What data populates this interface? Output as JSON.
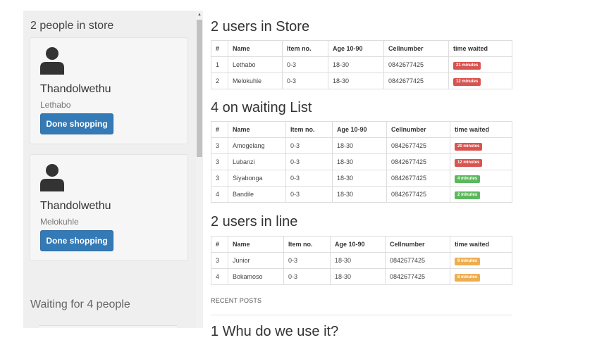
{
  "sidebar": {
    "in_store_heading": "2 people in store",
    "cards": [
      {
        "name": "Thandolwethu",
        "sub": "Lethabo",
        "button": "Done shopping"
      },
      {
        "name": "Thandolwethu",
        "sub": "Melokuhle",
        "button": "Done shopping"
      }
    ],
    "waiting_heading": "Waiting for 4 people"
  },
  "columns": [
    "#",
    "Name",
    "Item no.",
    "Age 10-90",
    "Cellnumber",
    "time waited"
  ],
  "store": {
    "title": "2 users in Store",
    "rows": [
      {
        "num": "1",
        "name": "Lethabo",
        "item": "0-3",
        "age": "18-30",
        "cell": "0842677425",
        "waited": "21 minutes",
        "status": "red"
      },
      {
        "num": "2",
        "name": "Melokuhle",
        "item": "0-3",
        "age": "18-30",
        "cell": "0842677425",
        "waited": "12 minutes",
        "status": "red"
      }
    ]
  },
  "waiting": {
    "title": "4 on waiting List",
    "rows": [
      {
        "num": "3",
        "name": "Amogelang",
        "item": "0-3",
        "age": "18-30",
        "cell": "0842677425",
        "waited": "20 minutes",
        "status": "red"
      },
      {
        "num": "3",
        "name": "Lubanzi",
        "item": "0-3",
        "age": "18-30",
        "cell": "0842677425",
        "waited": "12 minutes",
        "status": "red"
      },
      {
        "num": "3",
        "name": "Siyabonga",
        "item": "0-3",
        "age": "18-30",
        "cell": "0842677425",
        "waited": "4 minutes",
        "status": "green"
      },
      {
        "num": "4",
        "name": "Bandile",
        "item": "0-3",
        "age": "18-30",
        "cell": "0842677425",
        "waited": "2 minutes",
        "status": "green"
      }
    ]
  },
  "line": {
    "title": "2 users in line",
    "rows": [
      {
        "num": "3",
        "name": "Junior",
        "item": "0-3",
        "age": "18-30",
        "cell": "0842677425",
        "waited": "9 minutes",
        "status": "orange"
      },
      {
        "num": "4",
        "name": "Bokamoso",
        "item": "0-3",
        "age": "18-30",
        "cell": "0842677425",
        "waited": "8 minutes",
        "status": "orange"
      }
    ]
  },
  "recent_posts": "RECENT POSTS",
  "cut_heading": "1 Whu do we use it?",
  "icons": {
    "avatar": "person-icon",
    "scroll_up": "scroll-up-arrow-icon"
  },
  "colors": {
    "primary": "#337ab7",
    "danger": "#d9534f",
    "success": "#5cb85c",
    "warning": "#f0ad4e"
  }
}
